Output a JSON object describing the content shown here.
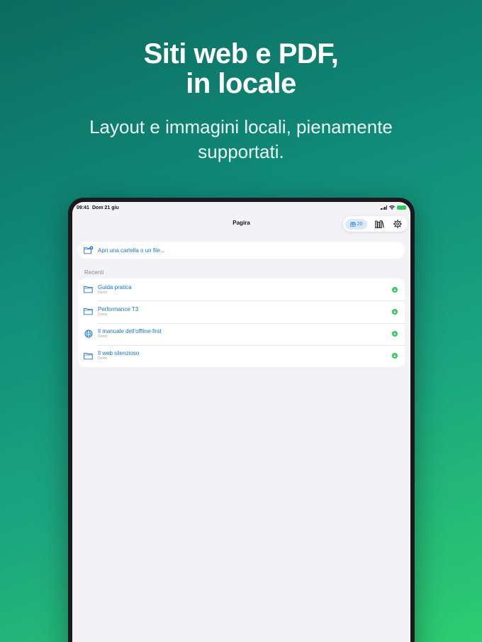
{
  "hero": {
    "title_line1": "Siti web e PDF,",
    "title_line2": "in locale",
    "subtitle_line1": "Layout e immagini locali, pienamente",
    "subtitle_line2": "supportati."
  },
  "status_bar": {
    "time": "09:41",
    "date": "Dom 21 giu"
  },
  "navbar": {
    "title": "Pagira",
    "badge_count": "20",
    "badge_icon": "gift-icon",
    "library_icon": "library-icon",
    "settings_icon": "gear-icon"
  },
  "open_row": {
    "label": "Apri una cartella o un file...",
    "icon": "folder-add-icon"
  },
  "recents": {
    "section_label": "Recenti",
    "items": [
      {
        "title": "Guida pratica",
        "subtitle": "Demo",
        "icon": "folder-icon"
      },
      {
        "title": "Performance T3",
        "subtitle": "Demo",
        "icon": "folder-icon"
      },
      {
        "title": "Il manuale dell'offline-first",
        "subtitle": "Demo",
        "icon": "globe-icon"
      },
      {
        "title": "Il web silenzioso",
        "subtitle": "Demo",
        "icon": "folder-icon"
      }
    ]
  },
  "colors": {
    "accent": "#1a73c9",
    "downloaded": "#34c759",
    "background_top": "#0c6b5f",
    "background_bottom": "#2ecc71"
  }
}
